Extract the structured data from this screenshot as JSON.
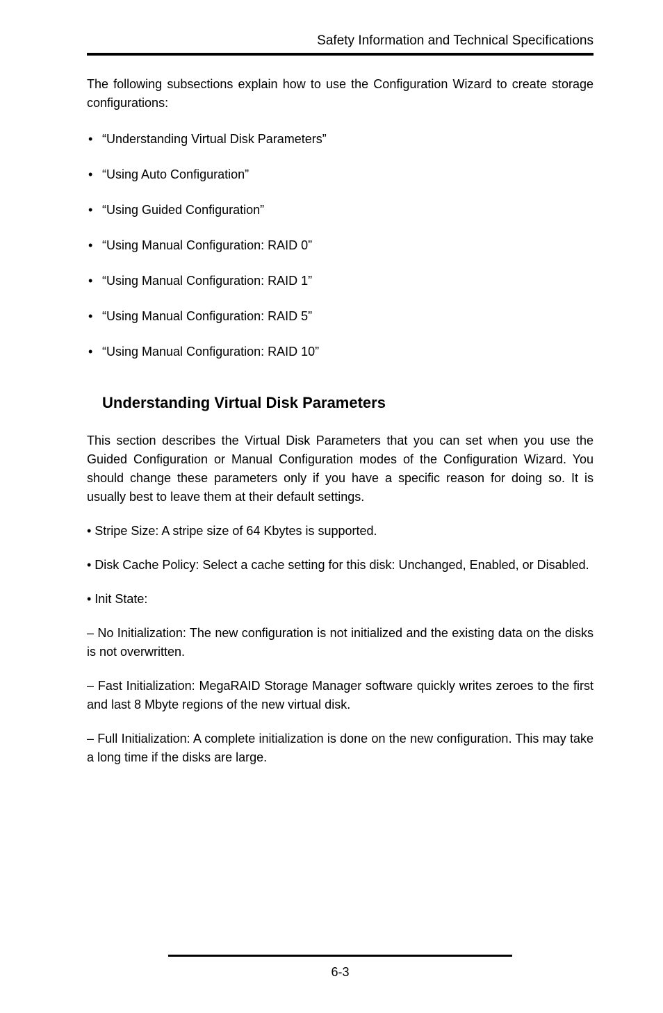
{
  "header": {
    "title": "Safety Information and Technical Specifications"
  },
  "intro": "The following subsections explain how to use the Configuration Wizard to create storage configurations:",
  "bullets": [
    "“Understanding Virtual Disk Parameters”",
    "“Using Auto Configuration”",
    "“Using Guided Configuration”",
    "“Using Manual Configuration: RAID 0”",
    "“Using Manual Configuration: RAID 1”",
    "“Using Manual Configuration: RAID 5”",
    "“Using Manual Configuration: RAID 10”"
  ],
  "section": {
    "heading": "Understanding Virtual Disk Parameters",
    "p1": "This section describes the Virtual Disk Parameters that you can set when you use the Guided Configuration or Manual Configuration modes of the Configuration Wizard. You should change these parameters only if you have a specific reason for doing so. It is usually best to leave them at their default settings.",
    "p2": "• Stripe Size: A stripe size of 64 Kbytes is supported.",
    "p3": "• Disk Cache Policy: Select a cache setting for this disk: Unchanged, Enabled, or Disabled.",
    "p4": "• Init State:",
    "p5": "– No Initialization: The new configuration is not initialized and the existing data on the disks is not overwritten.",
    "p6": "– Fast Initialization: MegaRAID Storage Manager software quickly writes zeroes to the first and last 8 Mbyte regions of the new virtual disk.",
    "p7": "– Full Initialization: A complete initialization is done on the new configuration. This may take a long time if the disks are large."
  },
  "footer": {
    "pagenum": "6-3"
  }
}
